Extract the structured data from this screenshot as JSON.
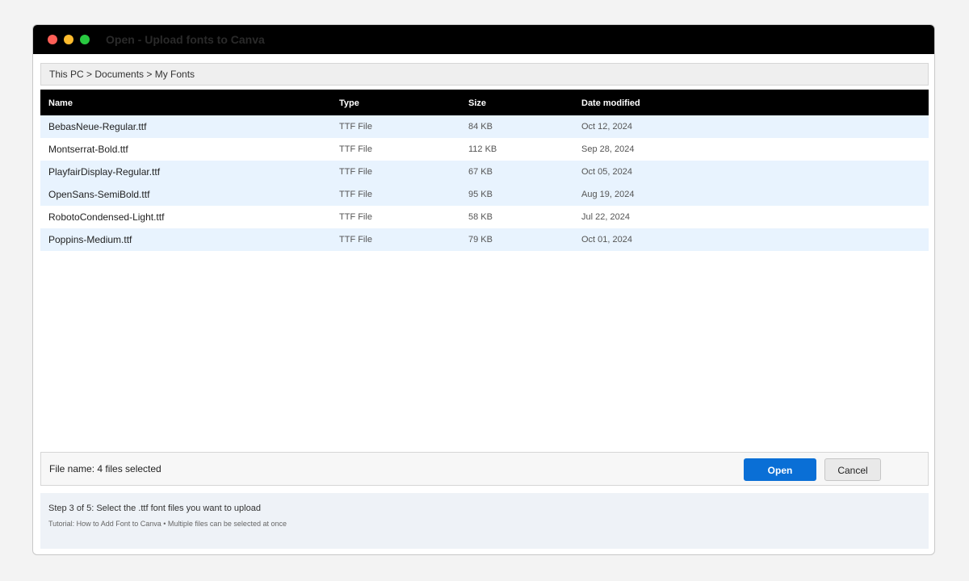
{
  "window": {
    "title": "Open - Upload fonts to Canva"
  },
  "breadcrumb": "This PC > Documents > My Fonts",
  "table": {
    "columns": [
      "Name",
      "Type",
      "Size",
      "Date modified"
    ],
    "rows": [
      {
        "name": "BebasNeue-Regular.ttf",
        "type": "TTF File",
        "size": "84 KB",
        "date": "Oct 12, 2024",
        "selected": true
      },
      {
        "name": "Montserrat-Bold.ttf",
        "type": "TTF File",
        "size": "112 KB",
        "date": "Sep 28, 2024",
        "selected": false
      },
      {
        "name": "PlayfairDisplay-Regular.ttf",
        "type": "TTF File",
        "size": "67 KB",
        "date": "Oct 05, 2024",
        "selected": true
      },
      {
        "name": "OpenSans-SemiBold.ttf",
        "type": "TTF File",
        "size": "95 KB",
        "date": "Aug 19, 2024",
        "selected": true
      },
      {
        "name": "RobotoCondensed-Light.ttf",
        "type": "TTF File",
        "size": "58 KB",
        "date": "Jul 22, 2024",
        "selected": false
      },
      {
        "name": "Poppins-Medium.ttf",
        "type": "TTF File",
        "size": "79 KB",
        "date": "Oct 01, 2024",
        "selected": true
      }
    ]
  },
  "footer": {
    "file_name": "File name: 4 files selected",
    "open_label": "Open",
    "cancel_label": "Cancel"
  },
  "info": {
    "step": "Step 3 of 5: Select the .ttf font files you want to upload",
    "tutorial": "Tutorial: How to Add Font to Canva • Multiple files can be selected at once"
  },
  "colors": {
    "accent": "#0a6fd6",
    "selected_row": "#e8f3fe",
    "header_bg": "#000000"
  }
}
